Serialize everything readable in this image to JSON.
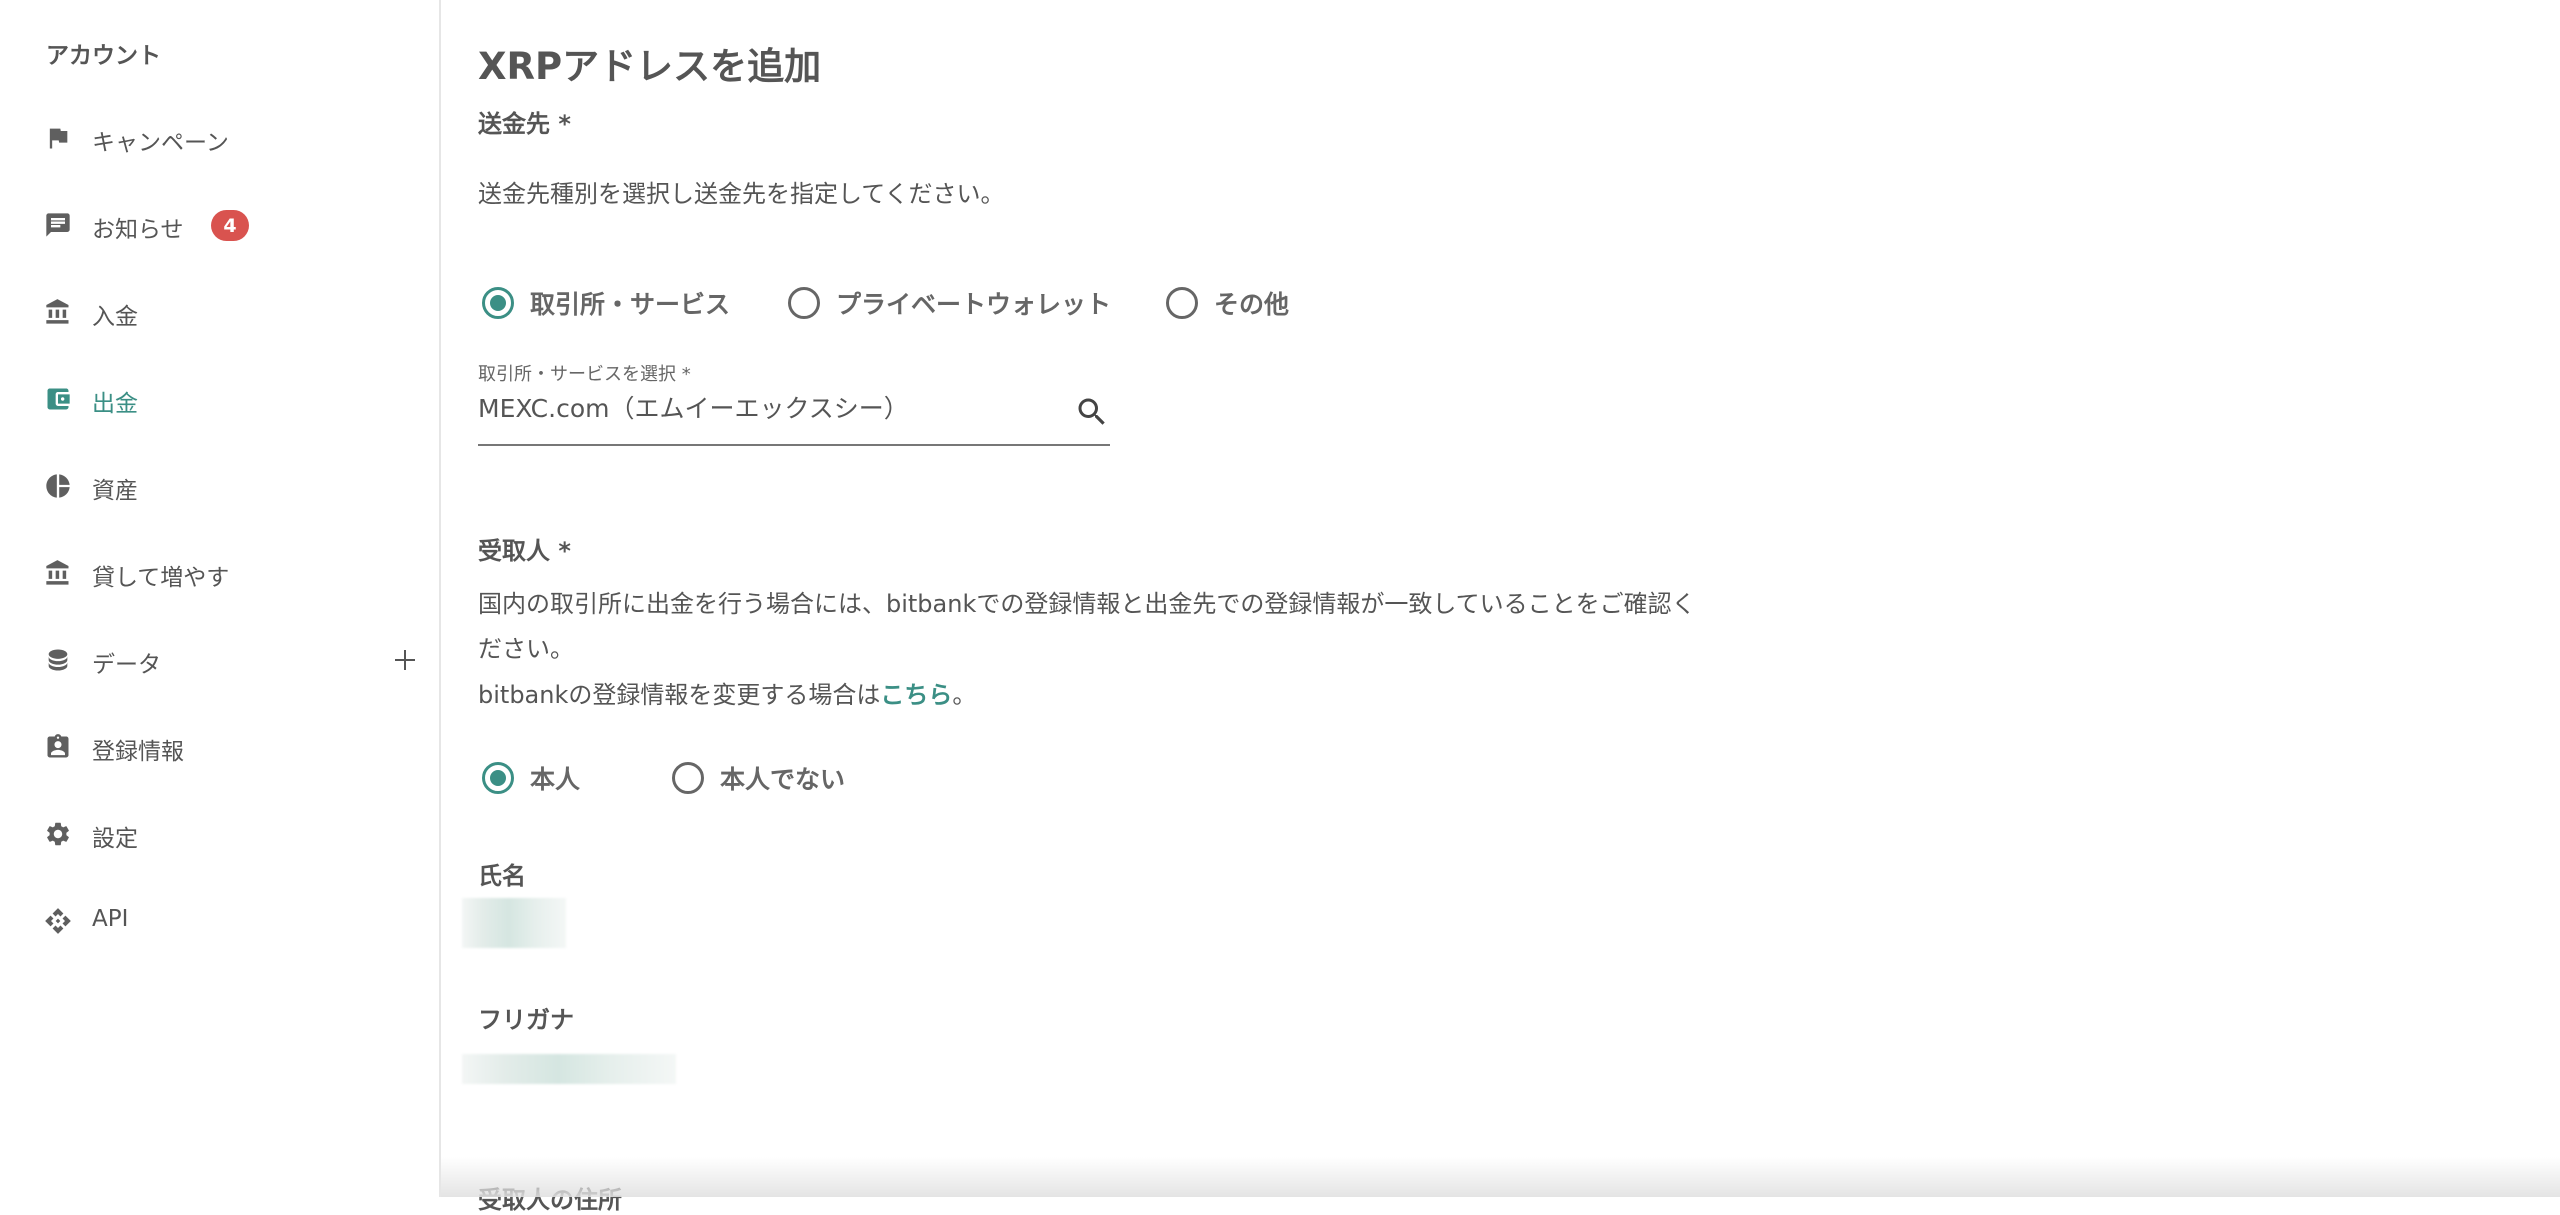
{
  "sidebar": {
    "title": "アカウント",
    "items": [
      {
        "label": "キャンペーン",
        "icon": "flag-icon"
      },
      {
        "label": "お知らせ",
        "icon": "chat-icon",
        "badge": "4"
      },
      {
        "label": "入金",
        "icon": "bank-icon"
      },
      {
        "label": "出金",
        "icon": "wallet-icon",
        "active": true
      },
      {
        "label": "資産",
        "icon": "pie-chart-icon"
      },
      {
        "label": "貸して増やす",
        "icon": "bank-icon"
      },
      {
        "label": "データ",
        "icon": "database-icon",
        "expandable": true
      },
      {
        "label": "登録情報",
        "icon": "badge-icon"
      },
      {
        "label": "設定",
        "icon": "gear-icon"
      },
      {
        "label": "API",
        "icon": "api-icon"
      }
    ]
  },
  "page": {
    "title": "XRPアドレスを追加",
    "destination": {
      "label": "送金先 *",
      "description": "送金先種別を選択し送金先を指定してください。",
      "options": [
        "取引所・サービス",
        "プライベートウォレット",
        "その他"
      ],
      "selected_index": 0,
      "select_caption": "取引所・サービスを選択 *",
      "select_value": "MEXC.com（エムイーエックスシー）"
    },
    "recipient": {
      "label": "受取人 *",
      "line1": "国内の取引所に出金を行う場合には、bitbankでの登録情報と出金先での登録情報が一致していることをご確認く",
      "line2": "ださい。",
      "line3_prefix": "bitbankの登録情報を変更する場合は",
      "line3_link": "こちら",
      "line3_suffix": "。",
      "options": [
        "本人",
        "本人でない"
      ],
      "selected_index": 0
    },
    "name_label": "氏名",
    "furigana_label": "フリガナ",
    "address_label": "受取人の住所"
  },
  "colors": {
    "accent": "#3b8f85",
    "badge": "#d9534f"
  }
}
